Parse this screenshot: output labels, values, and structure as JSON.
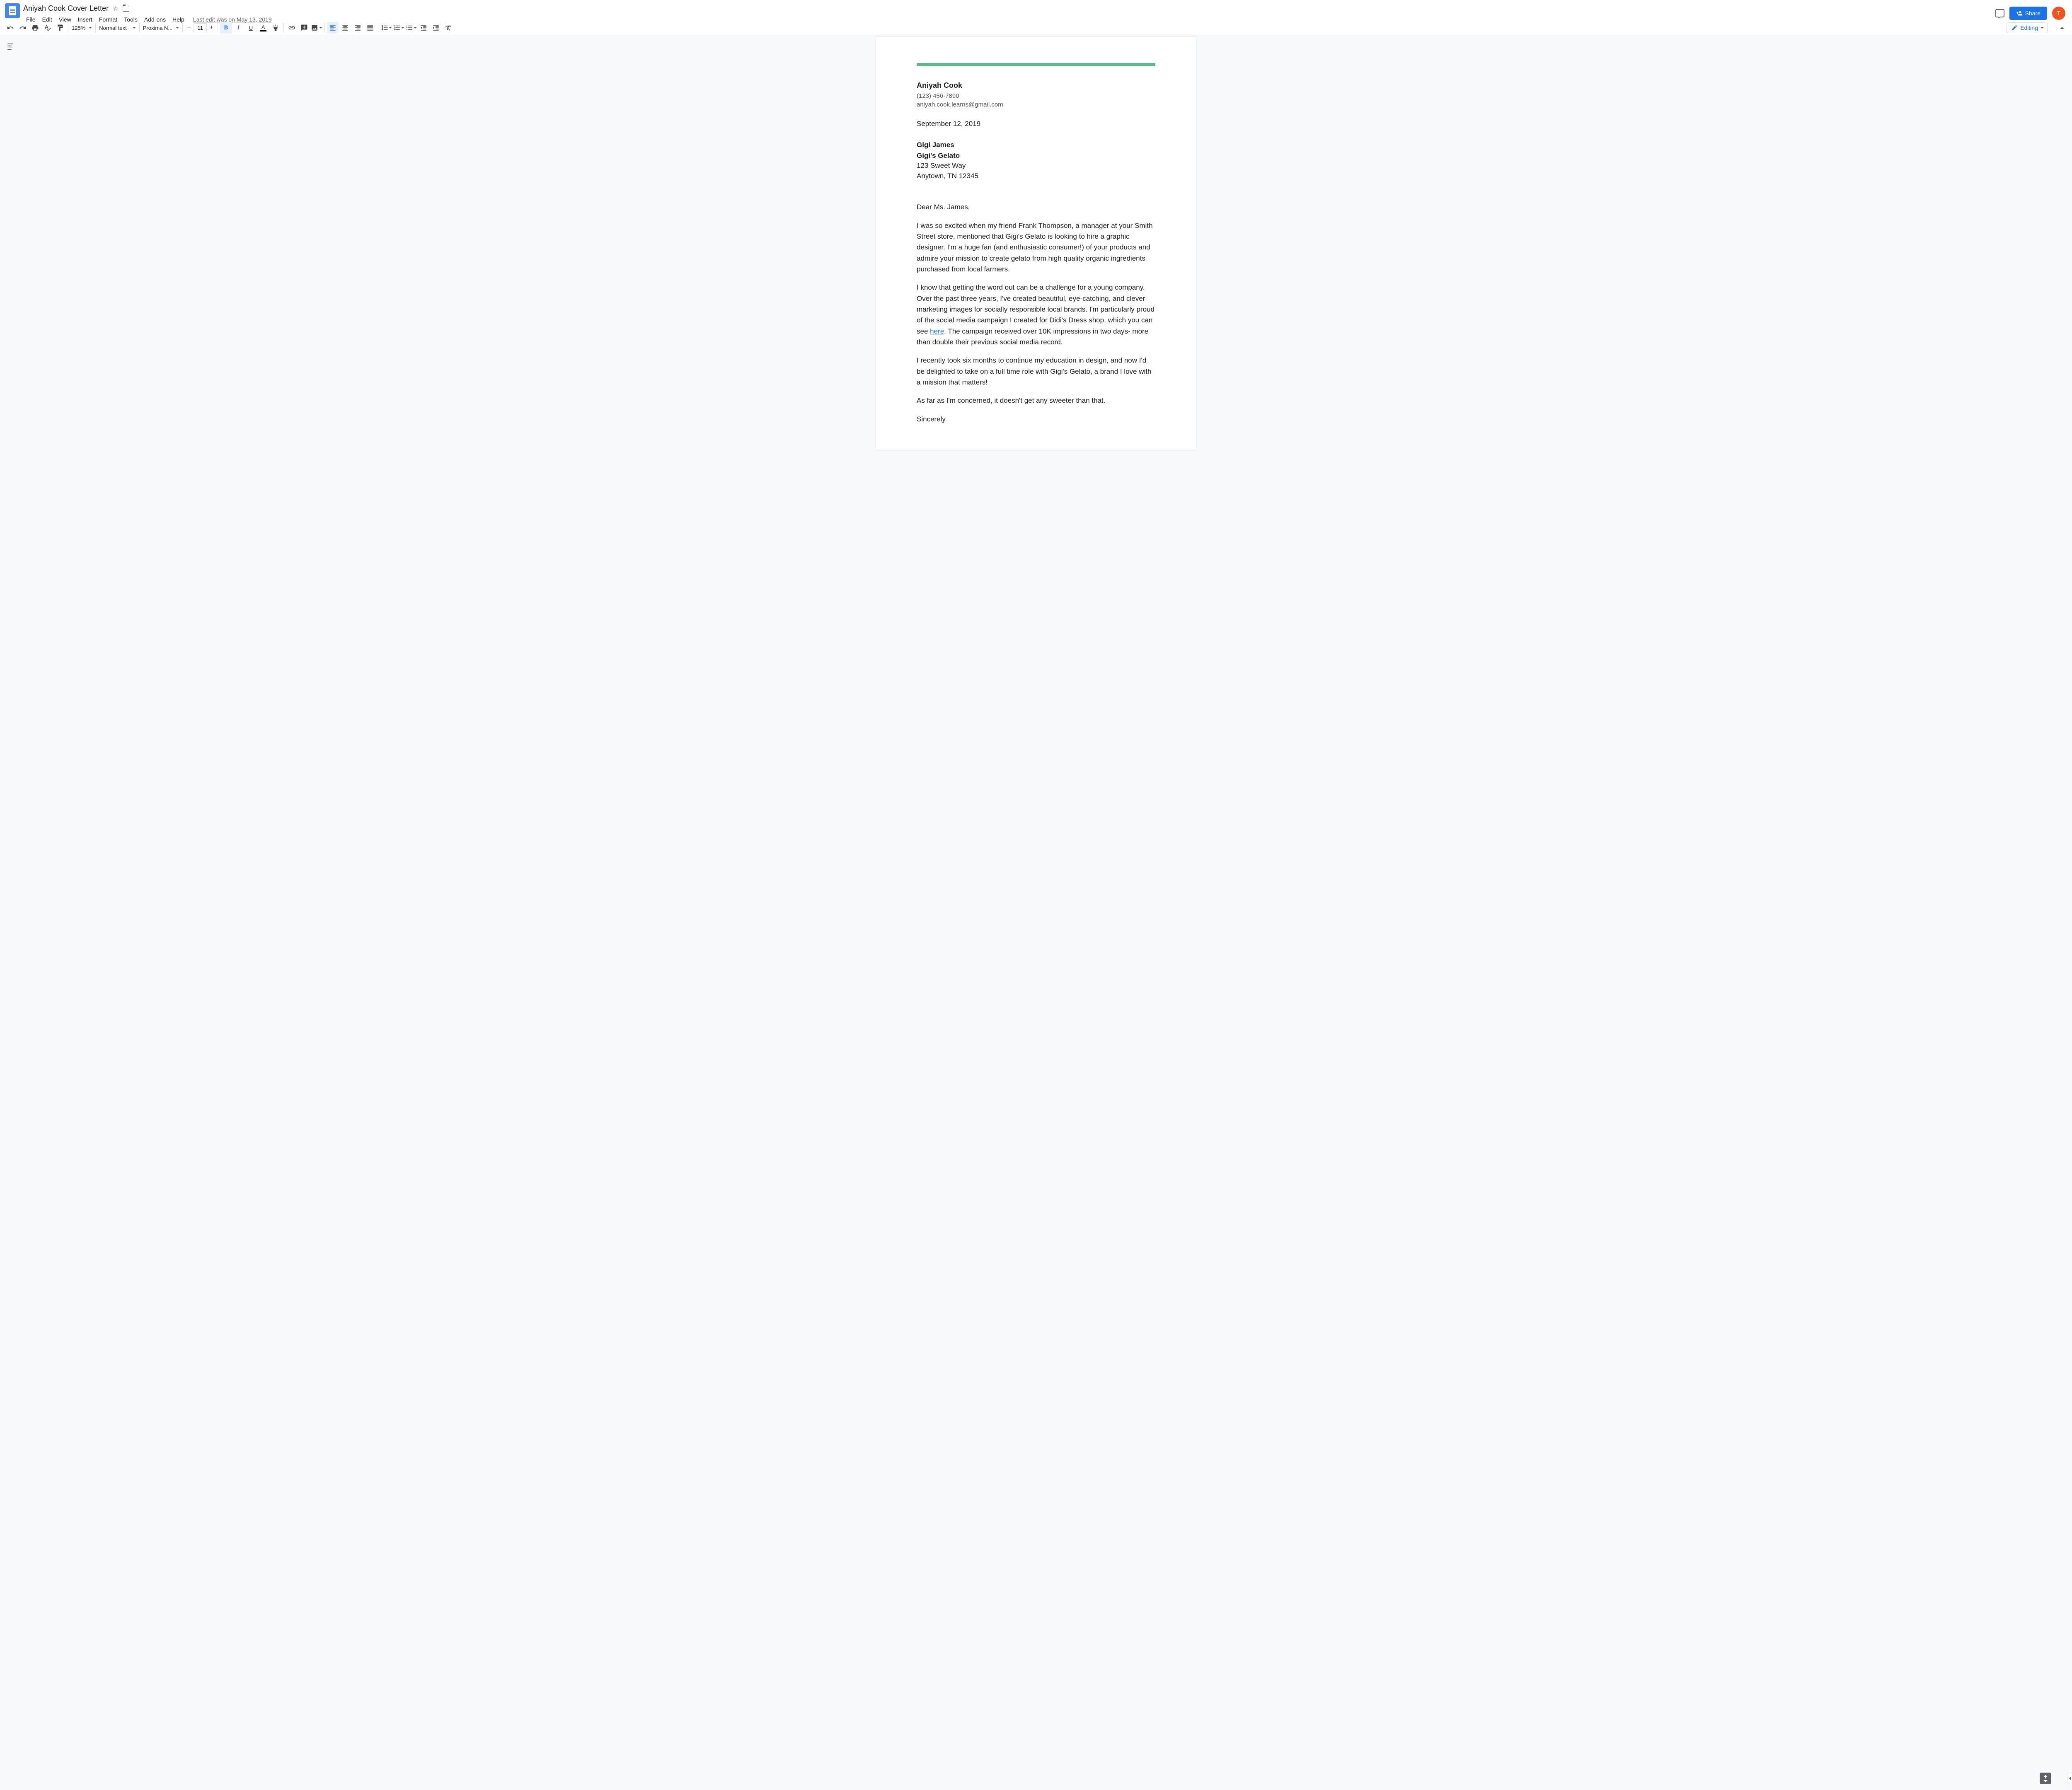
{
  "header": {
    "doc_title": "Aniyah Cook Cover Letter",
    "menus": [
      "File",
      "Edit",
      "View",
      "Insert",
      "Format",
      "Tools",
      "Add-ons",
      "Help"
    ],
    "last_edit": "Last edit was on May 13, 2019",
    "share_label": "Share",
    "avatar_initial": "T"
  },
  "toolbar": {
    "zoom": "125%",
    "style": "Normal text",
    "font": "Proxima N...",
    "font_size": "11",
    "editing_label": "Editing"
  },
  "document": {
    "accent_color": "#5fb88a",
    "sender": {
      "name": "Aniyah Cook",
      "phone": "(123) 456-7890",
      "email": "aniyah.cook.learns@gmail.com"
    },
    "date": "September 12, 2019",
    "recipient": {
      "name": "Gigi James",
      "company": "Gigi's Gelato",
      "street": "123 Sweet Way",
      "city_line": "Anytown, TN 12345"
    },
    "salutation": "Dear Ms. James,",
    "para1": "I was so excited when my friend Frank Thompson, a manager at your Smith Street store, mentioned that Gigi's Gelato is looking to hire a graphic designer. I'm a huge fan (and enthusiastic consumer!) of your products and admire your mission to create gelato from high quality organic ingredients purchased from local farmers.",
    "para2_pre": "I know that getting the word out can be a challenge for a young company. Over the past three years, I've created beautiful, eye-catching, and clever marketing images for socially responsible local brands. I'm particularly proud of the social media campaign I created for Didi's Dress shop, which you can see ",
    "para2_link": "here",
    "para2_post": ". The campaign received over 10K impressions in two days- more than double their previous social media record.",
    "para3": "I recently took six months to continue my education in design, and now I'd be delighted to take on a full time role with Gigi's Gelato, a brand I love with a mission that matters!",
    "para4": "As far as I'm concerned, it doesn't get any sweeter than that.",
    "closing": "Sincerely"
  }
}
